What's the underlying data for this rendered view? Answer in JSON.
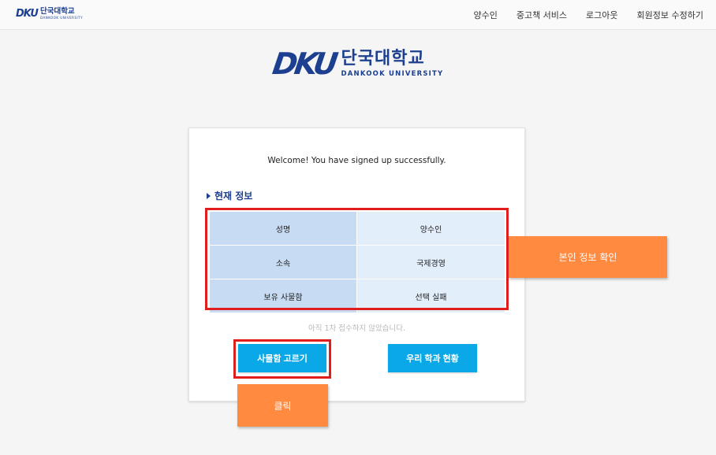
{
  "brand": {
    "abbr": "DKU",
    "name_kr": "단국대학교",
    "name_en": "DANKOOK UNIVERSITY"
  },
  "nav": {
    "items": [
      "양수인",
      "중고책 서비스",
      "로그아웃",
      "회원정보 수정하기"
    ]
  },
  "card": {
    "welcome": "Welcome! You have signed up successfully.",
    "section_title": "현재 정보",
    "info_rows": [
      {
        "label": "성명",
        "value": "양수인"
      },
      {
        "label": "소속",
        "value": "국제경영"
      },
      {
        "label": "보유 사물함",
        "value": "선택 실패"
      }
    ],
    "notice": "아직 1차 접수하지 않았습니다.",
    "pick_locker_label": "사물함 고르기",
    "dept_status_label": "우리 학과 현황"
  },
  "annotations": {
    "verify_label": "본인 정보 확인",
    "click_label": "클릭",
    "callout_color": "#ff8a40",
    "highlight_color": "#e01e1e"
  },
  "colors": {
    "brand": "#1d3f8f",
    "button": "#0aa8e6",
    "table_key_bg": "#c7dcf3",
    "table_value_bg": "#e3eefb"
  }
}
